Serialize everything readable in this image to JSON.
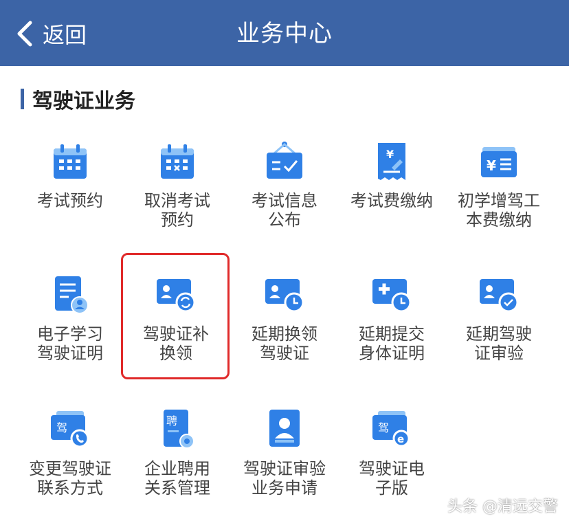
{
  "header": {
    "back_label": "返回",
    "title": "业务中心"
  },
  "section": {
    "title": "驾驶证业务"
  },
  "tiles": [
    {
      "label": "考试预约",
      "icon": "calendar-icon"
    },
    {
      "label": "取消考试\n预约",
      "icon": "calendar-cancel-icon"
    },
    {
      "label": "考试信息\n公布",
      "icon": "notice-board-icon"
    },
    {
      "label": "考试费缴纳",
      "icon": "receipt-yuan-icon"
    },
    {
      "label": "初学增驾工\n本费缴纳",
      "icon": "wallet-yuan-icon"
    },
    {
      "label": "电子学习\n驾驶证明",
      "icon": "document-user-icon"
    },
    {
      "label": "驾驶证补\n换领",
      "icon": "id-card-refresh-icon"
    },
    {
      "label": "延期换领\n驾驶证",
      "icon": "id-card-clock-icon"
    },
    {
      "label": "延期提交\n身体证明",
      "icon": "medical-clock-icon"
    },
    {
      "label": "延期驾驶\n证审验",
      "icon": "id-card-check-icon"
    },
    {
      "label": "变更驾驶证\n联系方式",
      "icon": "card-phone-icon"
    },
    {
      "label": "企业聘用\n关系管理",
      "icon": "document-gear-icon"
    },
    {
      "label": "驾驶证审验\n业务申请",
      "icon": "id-badge-icon"
    },
    {
      "label": "驾驶证电\n子版",
      "icon": "card-e-icon"
    }
  ],
  "colors": {
    "header_bg": "#3c64a6",
    "icon_blue": "#2f80e6",
    "icon_light": "#8ec3f7",
    "highlight": "#e02a2a"
  },
  "watermark": "头条 @清远交警"
}
